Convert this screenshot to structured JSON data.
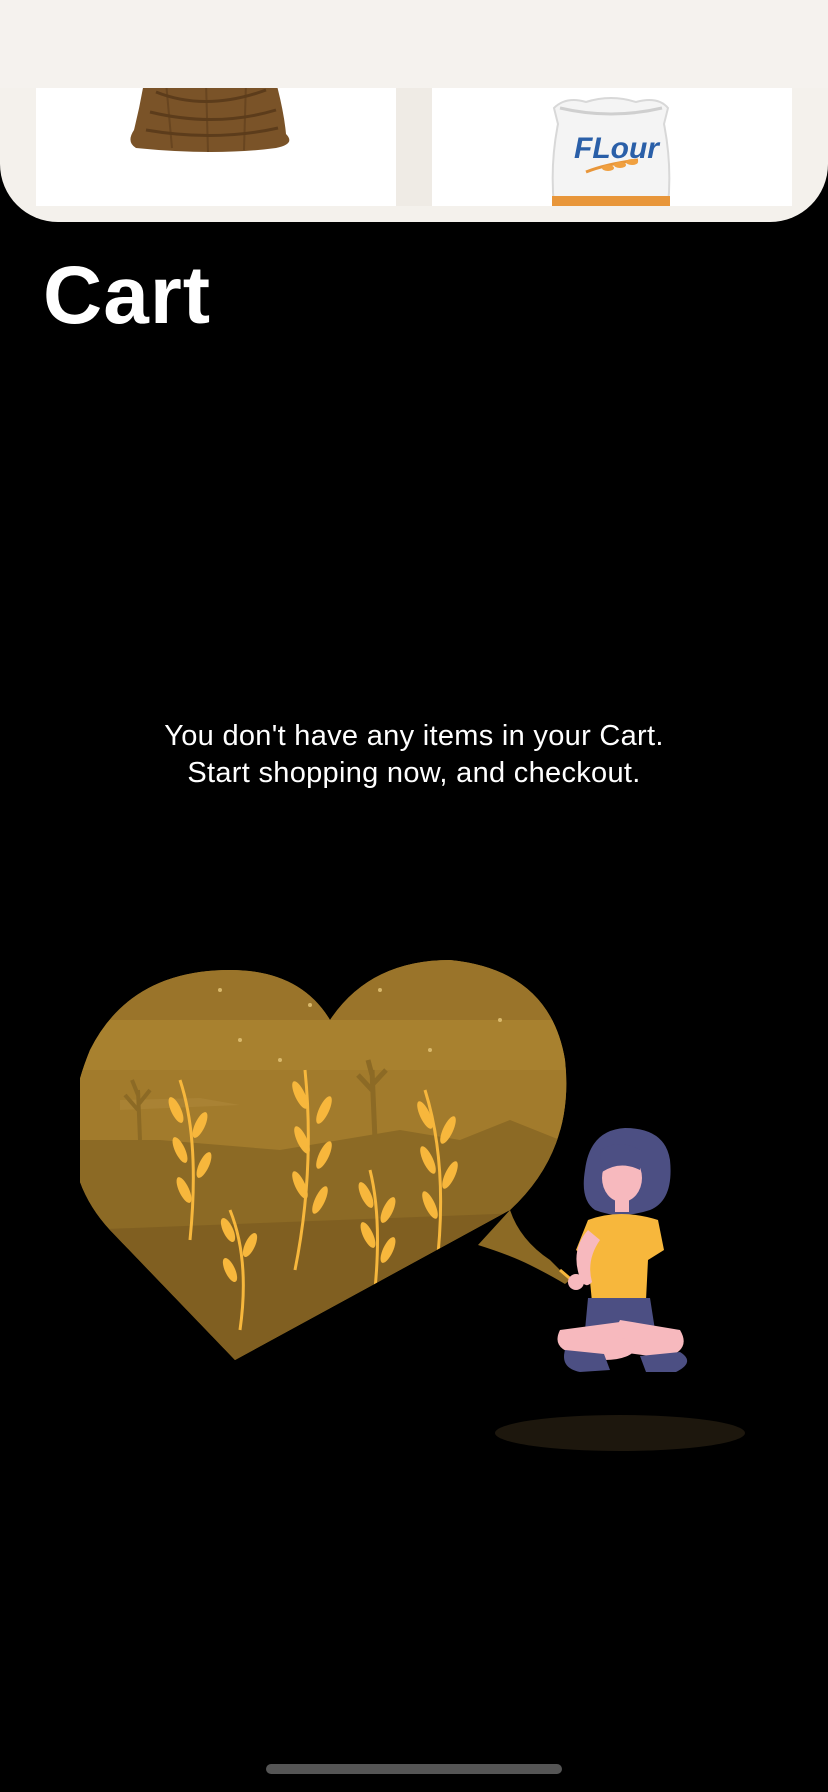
{
  "header": {
    "title": "Cart"
  },
  "background_sheet": {
    "items": [
      {
        "name": "sack-icon"
      },
      {
        "name": "flour-bag-icon",
        "label": "FLour"
      }
    ]
  },
  "empty_state": {
    "line1": "You don't have any items in your Cart.",
    "line2": "Start shopping now, and checkout."
  },
  "colors": {
    "background": "#000000",
    "text": "#ffffff",
    "accent_gold": "#a27b2c",
    "accent_yellow": "#f7b73c"
  }
}
